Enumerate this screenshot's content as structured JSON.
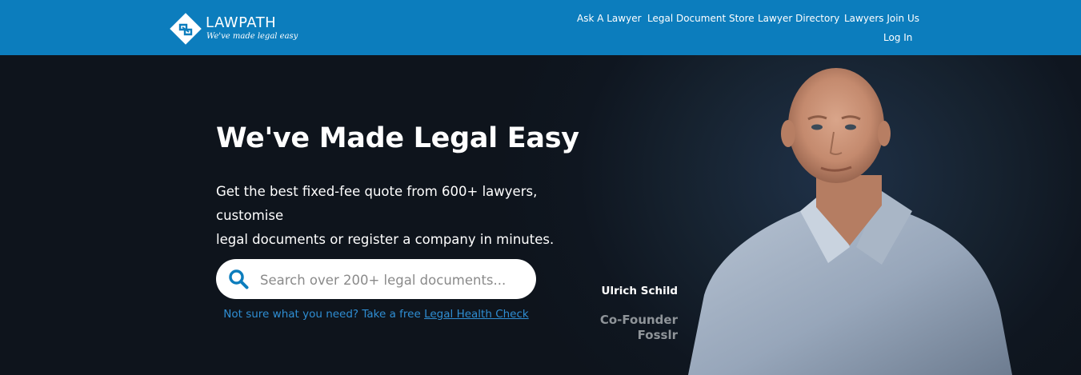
{
  "brand": {
    "name": "LAWPATH",
    "tagline": "We've made legal easy",
    "color": "#0c7dbd"
  },
  "nav": {
    "items": [
      "Ask A Lawyer",
      "Legal Document Store",
      "Lawyer Directory",
      "Lawyers Join Us"
    ],
    "login": "Log In"
  },
  "hero": {
    "title": "We've Made Legal Easy",
    "subtitle_line1": "Get the best fixed-fee quote from 600+ lawyers, customise",
    "subtitle_line2": "legal documents or register a company in minutes.",
    "search_placeholder": "Search over 200+ legal documents...",
    "health_prefix": "Not sure what you need? Take a free ",
    "health_link": "Legal Health Check"
  },
  "testimonial": {
    "name": "Ulrich Schild",
    "role": "Co-Founder",
    "company": "Fosslr"
  },
  "icons": {
    "logo": "lawpath-diamond-icon",
    "search": "search-icon"
  },
  "colors": {
    "accent": "#0c7dbd",
    "link": "#2f8ed3",
    "hero_bg": "#0f1720"
  }
}
